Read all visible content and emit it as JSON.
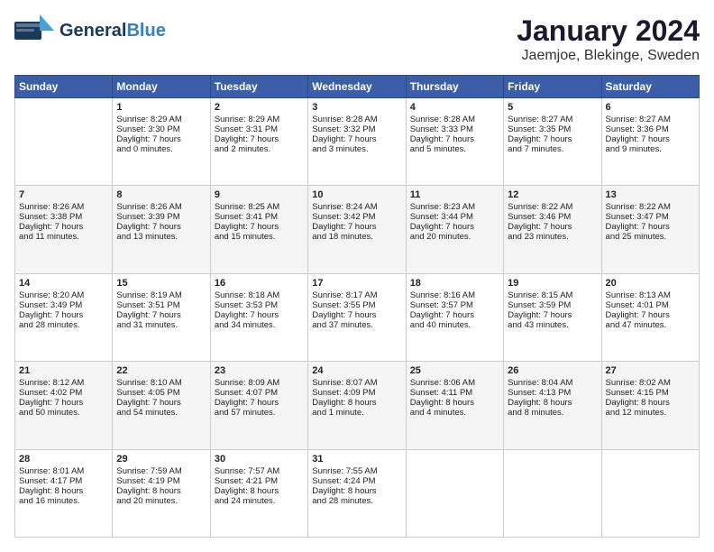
{
  "header": {
    "logo_general": "General",
    "logo_blue": "Blue",
    "month": "January 2024",
    "location": "Jaemjoe, Blekinge, Sweden"
  },
  "columns": [
    "Sunday",
    "Monday",
    "Tuesday",
    "Wednesday",
    "Thursday",
    "Friday",
    "Saturday"
  ],
  "weeks": [
    [
      {
        "num": "",
        "lines": []
      },
      {
        "num": "1",
        "lines": [
          "Sunrise: 8:29 AM",
          "Sunset: 3:30 PM",
          "Daylight: 7 hours",
          "and 0 minutes."
        ]
      },
      {
        "num": "2",
        "lines": [
          "Sunrise: 8:29 AM",
          "Sunset: 3:31 PM",
          "Daylight: 7 hours",
          "and 2 minutes."
        ]
      },
      {
        "num": "3",
        "lines": [
          "Sunrise: 8:28 AM",
          "Sunset: 3:32 PM",
          "Daylight: 7 hours",
          "and 3 minutes."
        ]
      },
      {
        "num": "4",
        "lines": [
          "Sunrise: 8:28 AM",
          "Sunset: 3:33 PM",
          "Daylight: 7 hours",
          "and 5 minutes."
        ]
      },
      {
        "num": "5",
        "lines": [
          "Sunrise: 8:27 AM",
          "Sunset: 3:35 PM",
          "Daylight: 7 hours",
          "and 7 minutes."
        ]
      },
      {
        "num": "6",
        "lines": [
          "Sunrise: 8:27 AM",
          "Sunset: 3:36 PM",
          "Daylight: 7 hours",
          "and 9 minutes."
        ]
      }
    ],
    [
      {
        "num": "7",
        "lines": [
          "Sunrise: 8:26 AM",
          "Sunset: 3:38 PM",
          "Daylight: 7 hours",
          "and 11 minutes."
        ]
      },
      {
        "num": "8",
        "lines": [
          "Sunrise: 8:26 AM",
          "Sunset: 3:39 PM",
          "Daylight: 7 hours",
          "and 13 minutes."
        ]
      },
      {
        "num": "9",
        "lines": [
          "Sunrise: 8:25 AM",
          "Sunset: 3:41 PM",
          "Daylight: 7 hours",
          "and 15 minutes."
        ]
      },
      {
        "num": "10",
        "lines": [
          "Sunrise: 8:24 AM",
          "Sunset: 3:42 PM",
          "Daylight: 7 hours",
          "and 18 minutes."
        ]
      },
      {
        "num": "11",
        "lines": [
          "Sunrise: 8:23 AM",
          "Sunset: 3:44 PM",
          "Daylight: 7 hours",
          "and 20 minutes."
        ]
      },
      {
        "num": "12",
        "lines": [
          "Sunrise: 8:22 AM",
          "Sunset: 3:46 PM",
          "Daylight: 7 hours",
          "and 23 minutes."
        ]
      },
      {
        "num": "13",
        "lines": [
          "Sunrise: 8:22 AM",
          "Sunset: 3:47 PM",
          "Daylight: 7 hours",
          "and 25 minutes."
        ]
      }
    ],
    [
      {
        "num": "14",
        "lines": [
          "Sunrise: 8:20 AM",
          "Sunset: 3:49 PM",
          "Daylight: 7 hours",
          "and 28 minutes."
        ]
      },
      {
        "num": "15",
        "lines": [
          "Sunrise: 8:19 AM",
          "Sunset: 3:51 PM",
          "Daylight: 7 hours",
          "and 31 minutes."
        ]
      },
      {
        "num": "16",
        "lines": [
          "Sunrise: 8:18 AM",
          "Sunset: 3:53 PM",
          "Daylight: 7 hours",
          "and 34 minutes."
        ]
      },
      {
        "num": "17",
        "lines": [
          "Sunrise: 8:17 AM",
          "Sunset: 3:55 PM",
          "Daylight: 7 hours",
          "and 37 minutes."
        ]
      },
      {
        "num": "18",
        "lines": [
          "Sunrise: 8:16 AM",
          "Sunset: 3:57 PM",
          "Daylight: 7 hours",
          "and 40 minutes."
        ]
      },
      {
        "num": "19",
        "lines": [
          "Sunrise: 8:15 AM",
          "Sunset: 3:59 PM",
          "Daylight: 7 hours",
          "and 43 minutes."
        ]
      },
      {
        "num": "20",
        "lines": [
          "Sunrise: 8:13 AM",
          "Sunset: 4:01 PM",
          "Daylight: 7 hours",
          "and 47 minutes."
        ]
      }
    ],
    [
      {
        "num": "21",
        "lines": [
          "Sunrise: 8:12 AM",
          "Sunset: 4:02 PM",
          "Daylight: 7 hours",
          "and 50 minutes."
        ]
      },
      {
        "num": "22",
        "lines": [
          "Sunrise: 8:10 AM",
          "Sunset: 4:05 PM",
          "Daylight: 7 hours",
          "and 54 minutes."
        ]
      },
      {
        "num": "23",
        "lines": [
          "Sunrise: 8:09 AM",
          "Sunset: 4:07 PM",
          "Daylight: 7 hours",
          "and 57 minutes."
        ]
      },
      {
        "num": "24",
        "lines": [
          "Sunrise: 8:07 AM",
          "Sunset: 4:09 PM",
          "Daylight: 8 hours",
          "and 1 minute."
        ]
      },
      {
        "num": "25",
        "lines": [
          "Sunrise: 8:06 AM",
          "Sunset: 4:11 PM",
          "Daylight: 8 hours",
          "and 4 minutes."
        ]
      },
      {
        "num": "26",
        "lines": [
          "Sunrise: 8:04 AM",
          "Sunset: 4:13 PM",
          "Daylight: 8 hours",
          "and 8 minutes."
        ]
      },
      {
        "num": "27",
        "lines": [
          "Sunrise: 8:02 AM",
          "Sunset: 4:15 PM",
          "Daylight: 8 hours",
          "and 12 minutes."
        ]
      }
    ],
    [
      {
        "num": "28",
        "lines": [
          "Sunrise: 8:01 AM",
          "Sunset: 4:17 PM",
          "Daylight: 8 hours",
          "and 16 minutes."
        ]
      },
      {
        "num": "29",
        "lines": [
          "Sunrise: 7:59 AM",
          "Sunset: 4:19 PM",
          "Daylight: 8 hours",
          "and 20 minutes."
        ]
      },
      {
        "num": "30",
        "lines": [
          "Sunrise: 7:57 AM",
          "Sunset: 4:21 PM",
          "Daylight: 8 hours",
          "and 24 minutes."
        ]
      },
      {
        "num": "31",
        "lines": [
          "Sunrise: 7:55 AM",
          "Sunset: 4:24 PM",
          "Daylight: 8 hours",
          "and 28 minutes."
        ]
      },
      {
        "num": "",
        "lines": []
      },
      {
        "num": "",
        "lines": []
      },
      {
        "num": "",
        "lines": []
      }
    ]
  ]
}
